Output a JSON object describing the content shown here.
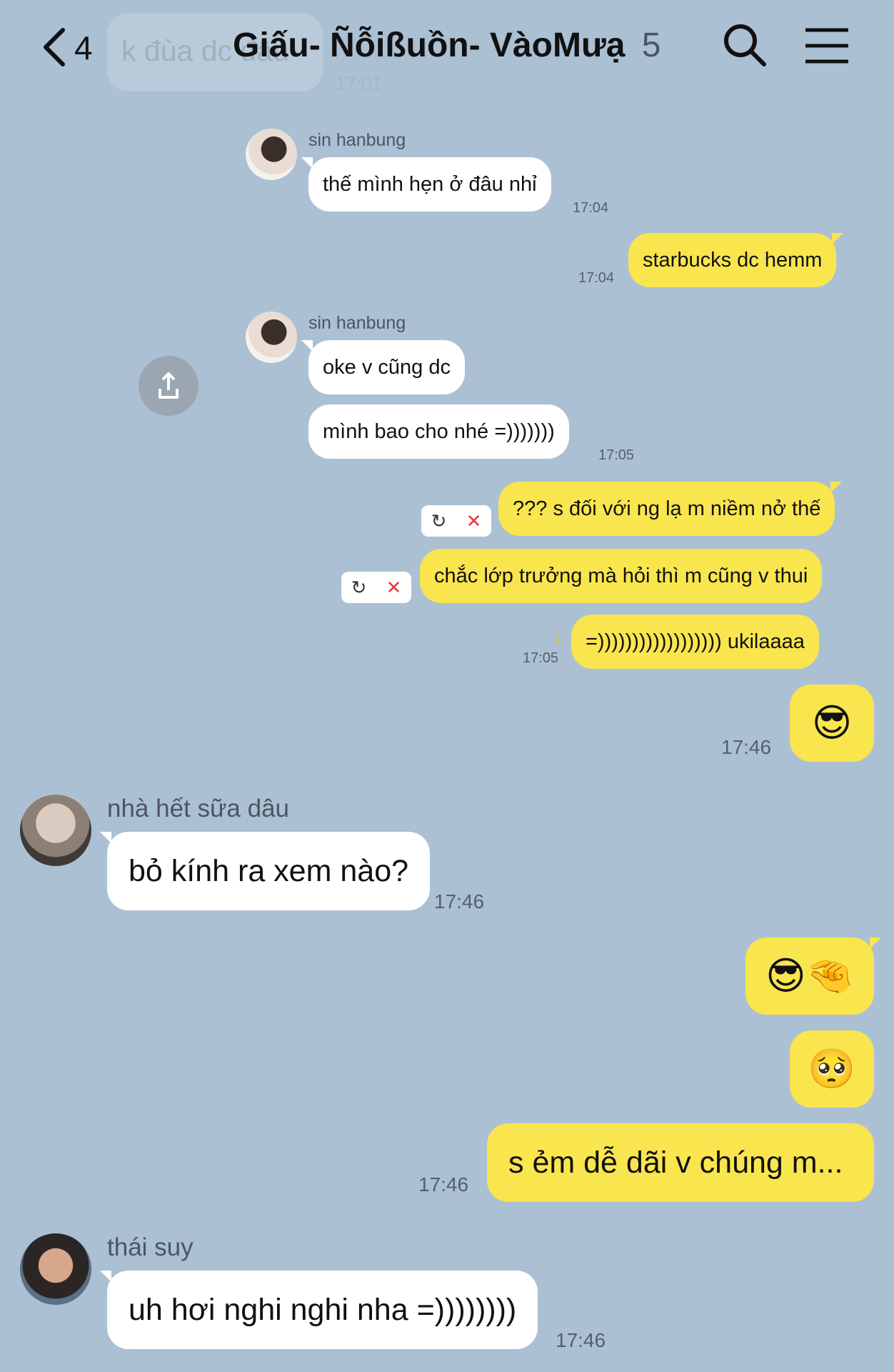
{
  "header": {
    "back_count": "4",
    "title": "Giấu- Ñỗißuồn- VàoMưạ",
    "member_count": "5",
    "faded_preview": "k đùa dc đâu",
    "faded_time": "17:01"
  },
  "messages": [
    {
      "sender": "sin hanbung",
      "text": "thế mình hẹn ở đâu nhỉ",
      "time": "17:04"
    },
    {
      "text": "starbucks dc hemm",
      "time": "17:04"
    },
    {
      "sender": "sin hanbung",
      "text": "oke v cũng dc"
    },
    {
      "text": "mình bao cho nhé =)))))))",
      "time": "17:05"
    },
    {
      "text": "??? s đối với ng lạ m niềm nở thế"
    },
    {
      "text": "chắc lớp trưởng mà hỏi thì m cũng v thui"
    },
    {
      "text": "=)))))))))))))))))) ukilaaaa",
      "time": "17:05",
      "unread": "1"
    },
    {
      "emoji": "😎",
      "time": "17:46"
    },
    {
      "sender": "nhà hết sữa dâu",
      "text": "bỏ kính ra xem nào?",
      "time": "17:46"
    },
    {
      "emoji": "😎🤏"
    },
    {
      "emoji": "🥺"
    },
    {
      "text": "s ẻm dễ dãi v chúng m...",
      "time": "17:46"
    },
    {
      "sender": "thái suy",
      "text": "uh hơi nghi nghi nha =))))))))",
      "time": "17:46"
    }
  ],
  "icons": {
    "back": "chevron-left",
    "search": "magnifier",
    "menu": "hamburger",
    "share": "upload-share",
    "retry": "↻",
    "delete": "✕"
  },
  "colors": {
    "background": "#acc0d4",
    "outgoing_bubble": "#f9e54e",
    "incoming_bubble": "#ffffff",
    "failed_delete": "#e8383d"
  }
}
